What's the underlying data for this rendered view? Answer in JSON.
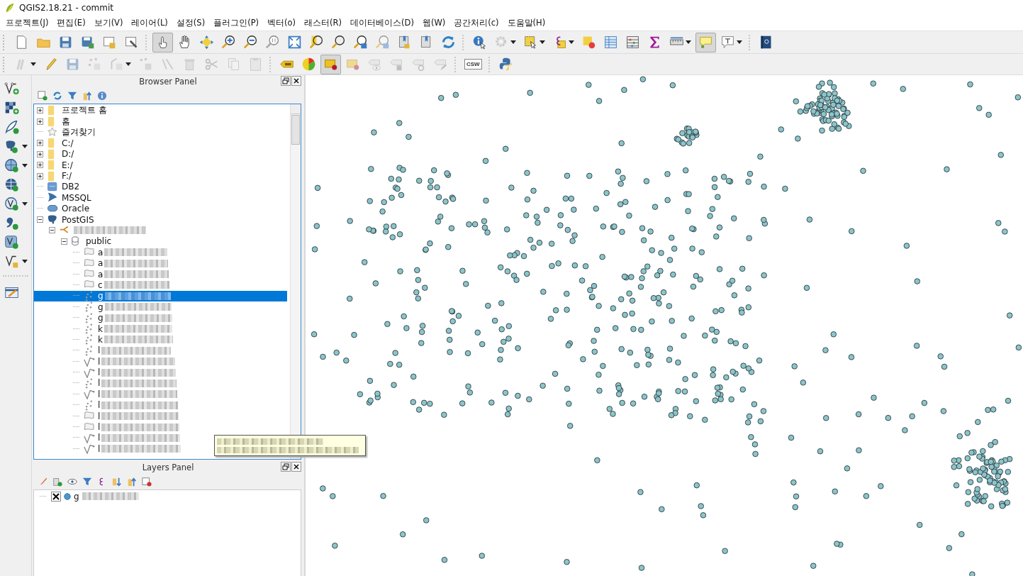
{
  "window": {
    "title": "QGIS2.18.21 - commit"
  },
  "menu": [
    "프로젝트(J)",
    "편집(E)",
    "보기(V)",
    "레이어(L)",
    "설정(S)",
    "플러그인(P)",
    "벡터(o)",
    "래스터(R)",
    "데이터베이스(D)",
    "웹(W)",
    "공간처리(c)",
    "도움말(H)"
  ],
  "toolbar_1": [
    {
      "kind": "new",
      "pressed": false,
      "disabled": false,
      "dropdown": false
    },
    {
      "kind": "open",
      "pressed": false,
      "disabled": false,
      "dropdown": false
    },
    {
      "kind": "save",
      "pressed": false,
      "disabled": false,
      "dropdown": false
    },
    {
      "kind": "saveas",
      "pressed": false,
      "disabled": false,
      "dropdown": false
    },
    {
      "kind": "composer",
      "pressed": false,
      "disabled": false,
      "dropdown": false
    },
    {
      "kind": "composermgr",
      "pressed": false,
      "disabled": false,
      "dropdown": false
    },
    {
      "kind": "sep"
    },
    {
      "kind": "touch",
      "pressed": true,
      "disabled": false,
      "dropdown": false
    },
    {
      "kind": "pan",
      "pressed": false,
      "disabled": false,
      "dropdown": false
    },
    {
      "kind": "pansel",
      "pressed": false,
      "disabled": false,
      "dropdown": false
    },
    {
      "kind": "zoomin",
      "pressed": false,
      "disabled": false,
      "dropdown": false
    },
    {
      "kind": "zoomout",
      "pressed": false,
      "disabled": false,
      "dropdown": false
    },
    {
      "kind": "zoom11",
      "pressed": false,
      "disabled": false,
      "dropdown": false
    },
    {
      "kind": "zoomfull",
      "pressed": false,
      "disabled": false,
      "dropdown": false
    },
    {
      "kind": "zoomsel",
      "pressed": false,
      "disabled": false,
      "dropdown": false
    },
    {
      "kind": "zoomlayer",
      "pressed": false,
      "disabled": false,
      "dropdown": false
    },
    {
      "kind": "zoomlast",
      "pressed": false,
      "disabled": false,
      "dropdown": false
    },
    {
      "kind": "zoomnext",
      "pressed": false,
      "disabled": true,
      "dropdown": false
    },
    {
      "kind": "bookmarknew",
      "pressed": false,
      "disabled": false,
      "dropdown": false
    },
    {
      "kind": "bookmarks",
      "pressed": false,
      "disabled": false,
      "dropdown": false
    },
    {
      "kind": "refresh",
      "pressed": false,
      "disabled": false,
      "dropdown": false
    },
    {
      "kind": "sep"
    },
    {
      "kind": "identify",
      "pressed": false,
      "disabled": false,
      "dropdown": false
    },
    {
      "kind": "action",
      "pressed": false,
      "disabled": true,
      "dropdown": true
    },
    {
      "kind": "select",
      "pressed": false,
      "disabled": false,
      "dropdown": true
    },
    {
      "kind": "selexpr",
      "pressed": false,
      "disabled": false,
      "dropdown": true
    },
    {
      "kind": "deselect",
      "pressed": false,
      "disabled": false,
      "dropdown": false
    },
    {
      "kind": "table",
      "pressed": false,
      "disabled": false,
      "dropdown": false
    },
    {
      "kind": "abacus",
      "pressed": false,
      "disabled": false,
      "dropdown": false
    },
    {
      "kind": "sigma",
      "pressed": false,
      "disabled": false,
      "dropdown": false
    },
    {
      "kind": "ruler",
      "pressed": false,
      "disabled": false,
      "dropdown": true
    },
    {
      "kind": "maptips",
      "pressed": true,
      "disabled": false,
      "dropdown": false
    },
    {
      "kind": "textann",
      "pressed": false,
      "disabled": false,
      "dropdown": true
    },
    {
      "kind": "sep"
    },
    {
      "kind": "help",
      "pressed": false,
      "disabled": false,
      "dropdown": false
    }
  ],
  "toolbar_2": [
    {
      "kind": "digitize",
      "pressed": false,
      "disabled": true,
      "dropdown": true
    },
    {
      "kind": "pencil",
      "pressed": false,
      "disabled": false,
      "dropdown": false
    },
    {
      "kind": "save",
      "pressed": false,
      "disabled": true,
      "dropdown": false
    },
    {
      "kind": "addpoint",
      "pressed": false,
      "disabled": true,
      "dropdown": false
    },
    {
      "kind": "vertex",
      "pressed": false,
      "disabled": true,
      "dropdown": true
    },
    {
      "kind": "movefeat",
      "pressed": false,
      "disabled": true,
      "dropdown": false
    },
    {
      "kind": "nodetool",
      "pressed": false,
      "disabled": true,
      "dropdown": false
    },
    {
      "kind": "trash",
      "pressed": false,
      "disabled": true,
      "dropdown": false
    },
    {
      "kind": "cut",
      "pressed": false,
      "disabled": true,
      "dropdown": false
    },
    {
      "kind": "copy",
      "pressed": false,
      "disabled": true,
      "dropdown": false
    },
    {
      "kind": "paste",
      "pressed": false,
      "disabled": true,
      "dropdown": false
    },
    {
      "kind": "sep"
    },
    {
      "kind": "label",
      "pressed": false,
      "disabled": false,
      "dropdown": false
    },
    {
      "kind": "pie",
      "pressed": false,
      "disabled": false,
      "dropdown": false
    },
    {
      "kind": "pinlabel",
      "pressed": true,
      "disabled": false,
      "dropdown": false
    },
    {
      "kind": "pinlabel",
      "pressed": false,
      "disabled": true,
      "dropdown": false
    },
    {
      "kind": "showlabel",
      "pressed": false,
      "disabled": true,
      "dropdown": false
    },
    {
      "kind": "movelabel",
      "pressed": false,
      "disabled": true,
      "dropdown": false
    },
    {
      "kind": "rotlabel",
      "pressed": false,
      "disabled": true,
      "dropdown": false
    },
    {
      "kind": "chglabel",
      "pressed": false,
      "disabled": true,
      "dropdown": false
    },
    {
      "kind": "sep"
    },
    {
      "kind": "csw",
      "text": "CSW",
      "pressed": false,
      "disabled": false,
      "dropdown": false
    },
    {
      "kind": "sep"
    },
    {
      "kind": "python",
      "pressed": false,
      "disabled": false,
      "dropdown": false
    }
  ],
  "left_toolbar": [
    {
      "kind": "addvector",
      "dropdown": false
    },
    {
      "kind": "addraster",
      "dropdown": false
    },
    {
      "kind": "feather",
      "dropdown": false
    },
    {
      "kind": "elephant",
      "dropdown": true
    },
    {
      "kind": "globe",
      "dropdown": true
    },
    {
      "kind": "globe2",
      "dropdown": false
    },
    {
      "kind": "vglobe",
      "dropdown": true
    },
    {
      "kind": "comma",
      "dropdown": false
    },
    {
      "kind": "virtual",
      "dropdown": false
    },
    {
      "kind": "newshape",
      "dropdown": true
    },
    {
      "kind": "sep"
    },
    {
      "kind": "form",
      "dropdown": false
    }
  ],
  "browser_panel": {
    "title": "Browser Panel",
    "items": [
      {
        "label": "프로젝트 홈",
        "kind": "folder",
        "expanded": false,
        "selected": false
      },
      {
        "label": "홈",
        "kind": "folder",
        "expanded": false,
        "selected": false
      },
      {
        "label": "즐겨찾기",
        "kind": "star",
        "selected": false
      },
      {
        "label": "C:/",
        "kind": "folder",
        "expanded": false,
        "selected": false
      },
      {
        "label": "D:/",
        "kind": "folder",
        "expanded": false,
        "selected": false
      },
      {
        "label": "E:/",
        "kind": "folder",
        "expanded": false,
        "selected": false
      },
      {
        "label": "F:/",
        "kind": "folder",
        "expanded": false,
        "selected": false
      },
      {
        "label": "DB2",
        "kind": "db2",
        "selected": false
      },
      {
        "label": "MSSQL",
        "kind": "mssql",
        "selected": false
      },
      {
        "label": "Oracle",
        "kind": "oracle",
        "selected": false
      },
      {
        "label": "PostGIS",
        "kind": "postgis",
        "expanded": true,
        "selected": false,
        "children": [
          {
            "kind": "connection",
            "redacted": true,
            "expanded": true,
            "selected": false,
            "children": [
              {
                "label": "public",
                "kind": "schema",
                "expanded": true,
                "selected": false,
                "children": [
                  {
                    "label": "a",
                    "kind": "polygon",
                    "redacted": true,
                    "selected": false
                  },
                  {
                    "label": "a",
                    "kind": "polygon",
                    "redacted": true,
                    "selected": false
                  },
                  {
                    "label": "a",
                    "kind": "polygon",
                    "redacted": true,
                    "selected": false
                  },
                  {
                    "label": "c",
                    "kind": "polygon",
                    "redacted": true,
                    "selected": false
                  },
                  {
                    "label": "g",
                    "kind": "point",
                    "redacted": true,
                    "selected": true
                  },
                  {
                    "label": "g",
                    "kind": "point",
                    "redacted": true,
                    "selected": false
                  },
                  {
                    "label": "g",
                    "kind": "point",
                    "redacted": true,
                    "selected": false
                  },
                  {
                    "label": "k",
                    "kind": "point",
                    "redacted": true,
                    "selected": false
                  },
                  {
                    "label": "k",
                    "kind": "point",
                    "redacted": true,
                    "selected": false
                  },
                  {
                    "label": "l",
                    "kind": "point",
                    "redacted": true,
                    "selected": false
                  },
                  {
                    "label": "l",
                    "kind": "line",
                    "redacted": true,
                    "selected": false
                  },
                  {
                    "label": "l",
                    "kind": "line",
                    "redacted": true,
                    "selected": false
                  },
                  {
                    "label": "l",
                    "kind": "point",
                    "redacted": true,
                    "selected": false
                  },
                  {
                    "label": "l",
                    "kind": "line",
                    "redacted": true,
                    "selected": false
                  },
                  {
                    "label": "l",
                    "kind": "point",
                    "redacted": true,
                    "selected": false
                  },
                  {
                    "label": "l",
                    "kind": "polygon",
                    "redacted": true,
                    "selected": false
                  },
                  {
                    "label": "l",
                    "kind": "polygon",
                    "redacted": true,
                    "selected": false
                  },
                  {
                    "label": "l",
                    "kind": "line",
                    "redacted": true,
                    "selected": false
                  },
                  {
                    "label": "l",
                    "kind": "line",
                    "redacted": true,
                    "selected": false
                  }
                ]
              }
            ]
          }
        ]
      }
    ]
  },
  "tooltip": {
    "lines": [
      {
        "redacted": true
      },
      {
        "redacted": true
      }
    ]
  },
  "layers_panel": {
    "title": "Layers Panel",
    "layers": [
      {
        "label": "g",
        "redacted": true,
        "visible": true,
        "selected": false
      }
    ]
  }
}
